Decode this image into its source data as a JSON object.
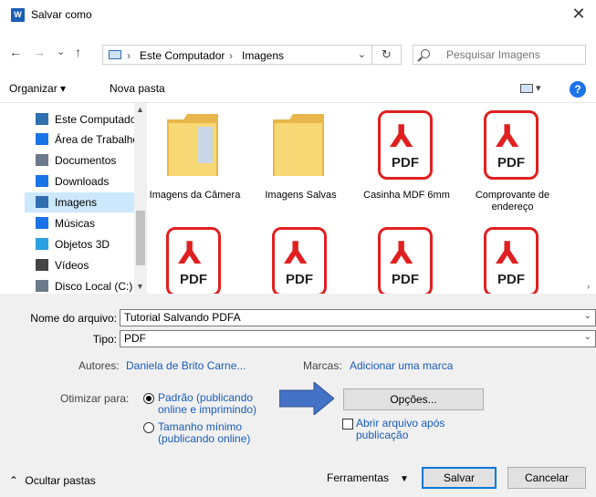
{
  "window": {
    "title": "Salvar como",
    "app_icon": "W"
  },
  "nav": {
    "back": "←",
    "forward": "→",
    "recent": "⌄",
    "up": "↑",
    "path": [
      "Este Computador",
      "Imagens"
    ],
    "separator": "›",
    "refresh": "↻",
    "search_placeholder": "Pesquisar Imagens"
  },
  "toolbar": {
    "organize": "Organizar ▾",
    "new_folder": "Nova pasta",
    "help": "?"
  },
  "sidebar": {
    "items": [
      {
        "label": "Este Computador",
        "icon": "computer-icon",
        "color": "#2f6fb0"
      },
      {
        "label": "Área de Trabalho",
        "icon": "desktop-icon",
        "color": "#1a73e8"
      },
      {
        "label": "Documentos",
        "icon": "documents-icon",
        "color": "#6a7a8a"
      },
      {
        "label": "Downloads",
        "icon": "downloads-icon",
        "color": "#1a73e8"
      },
      {
        "label": "Imagens",
        "icon": "pictures-icon",
        "color": "#2f6fb0"
      },
      {
        "label": "Músicas",
        "icon": "music-icon",
        "color": "#1a73e8"
      },
      {
        "label": "Objetos 3D",
        "icon": "objects3d-icon",
        "color": "#29a0e0"
      },
      {
        "label": "Vídeos",
        "icon": "videos-icon",
        "color": "#444444"
      },
      {
        "label": "Disco Local (C:)",
        "icon": "drive-icon",
        "color": "#6a7a8a"
      }
    ],
    "selected_index": 4
  },
  "files": [
    {
      "name": "Imagens da Câmera",
      "type": "folder"
    },
    {
      "name": "Imagens Salvas",
      "type": "folder"
    },
    {
      "name": "Casinha MDF 6mm",
      "type": "pdf"
    },
    {
      "name": "Comprovante de endereço",
      "type": "pdf"
    },
    {
      "name": "",
      "type": "pdf"
    },
    {
      "name": "",
      "type": "pdf"
    },
    {
      "name": "",
      "type": "pdf"
    },
    {
      "name": "",
      "type": "pdf"
    }
  ],
  "pdf_badge": "PDF",
  "form": {
    "filename_label": "Nome do arquivo:",
    "filename_value": "Tutorial Salvando PDFA",
    "type_label": "Tipo:",
    "type_value": "PDF",
    "authors_label": "Autores:",
    "authors_value": "Daniela de Brito Carne...",
    "tags_label": "Marcas:",
    "tags_value": "Adicionar uma marca",
    "optimize_label": "Otimizar para:",
    "optimize_standard": "Padrão (publicando online e imprimindo)",
    "optimize_min": "Tamanho mínimo (publicando online)",
    "optimize_selected": "standard",
    "options_button": "Opções...",
    "open_after_label": "Abrir arquivo após publicação",
    "open_after_checked": false,
    "tools_label": "Ferramentas",
    "save_label": "Salvar",
    "cancel_label": "Cancelar",
    "hide_folders_label": "Ocultar pastas"
  },
  "colors": {
    "accent": "#0078d7",
    "link": "#1a5cb8",
    "pdf_red": "#e02020",
    "folder": "#f5c542",
    "arrow": "#4472c4"
  }
}
